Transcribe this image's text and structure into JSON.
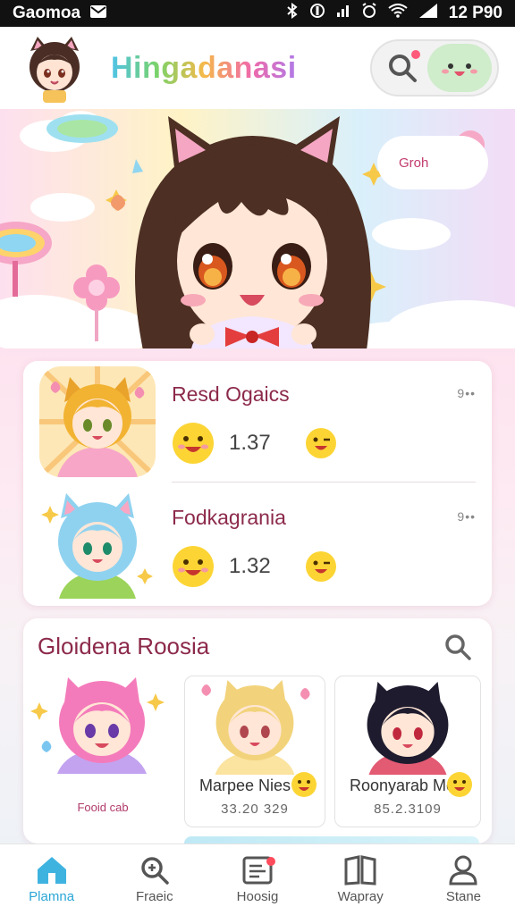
{
  "status_bar": {
    "carrier": "Gaomoa",
    "time": "12 P90"
  },
  "header": {
    "app_title": "Hingadanasi",
    "icons": [
      "search-icon",
      "mascot-face-icon"
    ]
  },
  "banner": {
    "tag_text": "Groh"
  },
  "list": {
    "items": [
      {
        "title": "Resd Ogaics",
        "count": "1.37"
      },
      {
        "title": "Fodkagrania",
        "count": "1.32"
      }
    ],
    "menu_glyph": "9••"
  },
  "recommended": {
    "title": "Gloidena Roosia",
    "items": [
      {
        "name": "",
        "caption": "Fooid cab",
        "value": ""
      },
      {
        "name": "Marpee Nies",
        "caption": "",
        "value": "33.20 329"
      },
      {
        "name": "Roonyarab Moa",
        "caption": "",
        "value": "85.2.3109"
      }
    ]
  },
  "bottom_nav": {
    "items": [
      {
        "label": "Plamna",
        "icon": "home-icon"
      },
      {
        "label": "Fraeic",
        "icon": "search-icon"
      },
      {
        "label": "Hoosig",
        "icon": "inbox-icon"
      },
      {
        "label": "Wapray",
        "icon": "book-icon"
      },
      {
        "label": "Stane",
        "icon": "profile-icon"
      }
    ]
  },
  "colors": {
    "accent": "#2aa6d6",
    "title_text": "#8c2a4a",
    "badge": "#ff4b5c"
  }
}
